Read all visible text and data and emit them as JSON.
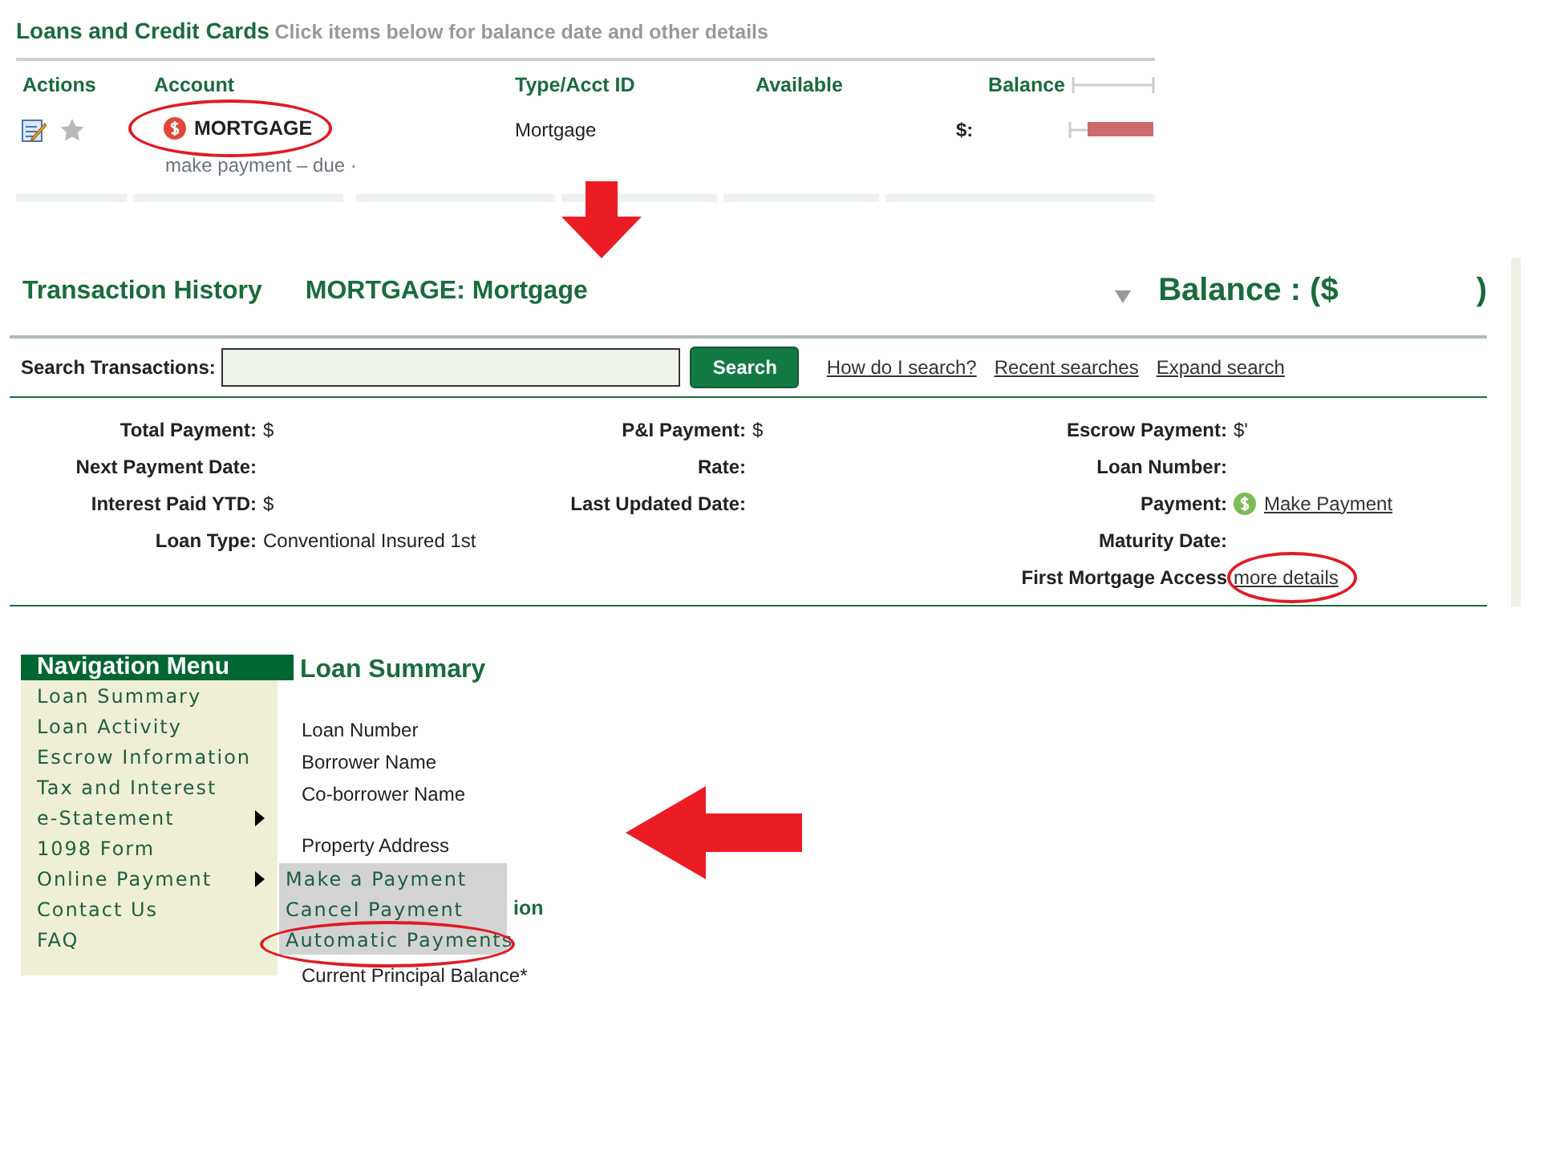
{
  "accounts_panel": {
    "title": "Loans and Credit Cards",
    "hint": "Click items below for balance date and other details",
    "columns": [
      "Actions",
      "Account",
      "Type/Acct ID",
      "Available",
      "Balance"
    ],
    "rows": [
      {
        "account": "MORTGAGE",
        "circled": true,
        "type": "Mortgage",
        "balance": "$:",
        "note": "make payment – due ·"
      }
    ]
  },
  "transaction_history": {
    "title": "Transaction History",
    "account": "MORTGAGE: Mortgage",
    "balance_label": "Balance : ($",
    "balance_close": ")",
    "search": {
      "label": "Search Transactions:",
      "button": "Search",
      "links": [
        "How do I search?",
        "Recent searches",
        "Expand search"
      ]
    },
    "details": [
      [
        {
          "kind": "text",
          "label": "Total Payment:",
          "value": "$"
        },
        {
          "kind": "text",
          "label": "Next Payment Date:"
        },
        {
          "kind": "text",
          "label": "Interest Paid YTD:",
          "value": "$"
        },
        {
          "kind": "text",
          "label": "Loan Type:",
          "value": "Conventional Insured 1st"
        }
      ],
      [
        {
          "kind": "text",
          "label": "P&I Payment:",
          "value": "$"
        },
        {
          "kind": "text",
          "label": "Rate:"
        },
        {
          "kind": "text",
          "label": "Last Updated Date:"
        }
      ],
      [
        {
          "kind": "text",
          "label": "Escrow Payment:",
          "value": "$'"
        },
        {
          "kind": "text",
          "label": "Loan Number:"
        },
        {
          "kind": "payment-link",
          "label": "Payment:",
          "value": "Make Payment"
        },
        {
          "kind": "text",
          "label": "Maturity Date:"
        },
        {
          "kind": "link",
          "label": "First Mortgage Access",
          "value": "more details",
          "circled": true
        }
      ]
    ]
  },
  "navigation_menu": {
    "title": "Navigation Menu",
    "items": [
      {
        "label": "Loan Summary",
        "has_submenu": false
      },
      {
        "label": "Loan Activity",
        "has_submenu": false
      },
      {
        "label": "Escrow Information",
        "has_submenu": false
      },
      {
        "label": "Tax and Interest",
        "has_submenu": false
      },
      {
        "label": "e-Statement",
        "has_submenu": true
      },
      {
        "label": "1098 Form",
        "has_submenu": false
      },
      {
        "label": "Online Payment",
        "has_submenu": true,
        "expanded": true,
        "submenu": [
          {
            "label": "Make a Payment",
            "circled": false
          },
          {
            "label": "Cancel Payment",
            "circled": false
          },
          {
            "label": "Automatic Payments",
            "circled": true
          }
        ]
      },
      {
        "label": "Contact Us",
        "has_submenu": false
      },
      {
        "label": "FAQ",
        "has_submenu": false
      }
    ]
  },
  "loan_summary": {
    "title": "Loan Summary",
    "fields": [
      "Loan Number",
      "Borrower Name",
      "Co-borrower Name",
      "Property Address"
    ],
    "section_heading": "ion",
    "balance_label": "Current Principal Balance*"
  }
}
